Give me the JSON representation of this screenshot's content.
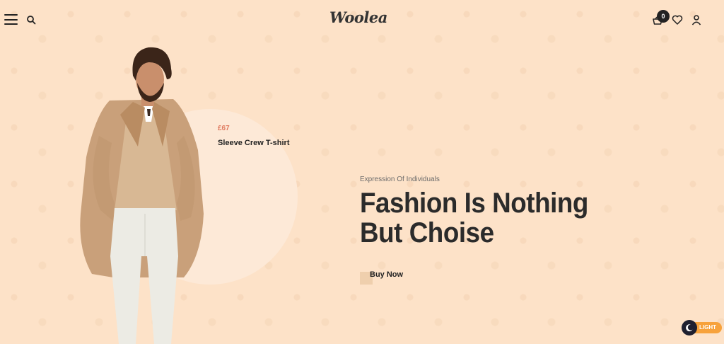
{
  "header": {
    "logo_text": "Woolea",
    "cart_count": "0",
    "icons": [
      "menu-icon",
      "search-icon",
      "cart-icon",
      "heart-icon",
      "user-icon"
    ]
  },
  "hero": {
    "product": {
      "price": "£67",
      "name": "Sleeve Crew T-shirt"
    },
    "subtitle": "Expression Of Individuals",
    "headline_line1": "Fashion Is Nothing",
    "headline_line2": "But Choise",
    "cta_label": "Buy Now"
  },
  "theme_toggle": {
    "label": "LIGHT",
    "icon": "moon-icon"
  },
  "colors": {
    "background": "#fde2c8",
    "accent_price": "#e07a5f",
    "toggle": "#f7a23c",
    "text_dark": "#2b2b2b"
  }
}
